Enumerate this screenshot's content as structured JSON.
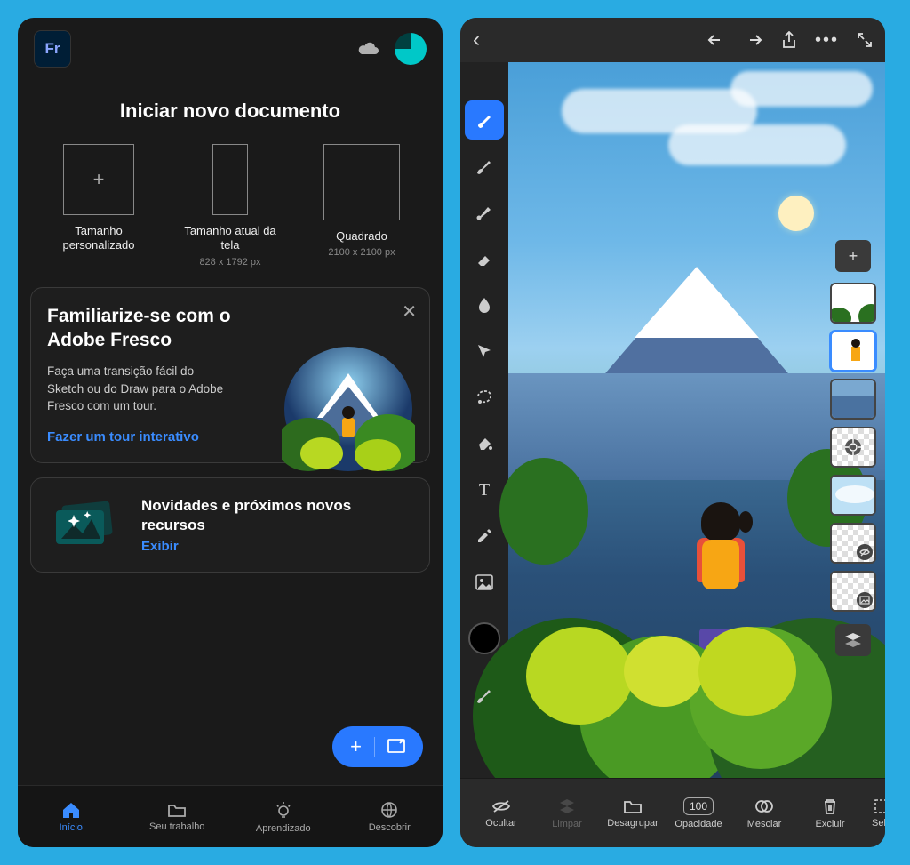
{
  "left": {
    "logo_text": "Fr",
    "section_title": "Iniciar novo documento",
    "presets": {
      "custom": {
        "label": "Tamanho personalizado",
        "plus": "+"
      },
      "screen": {
        "label": "Tamanho atual da tela",
        "dim": "828 x 1792 px"
      },
      "square": {
        "label": "Quadrado",
        "dim": "2100 x 2100 px"
      }
    },
    "tour_card": {
      "title": "Familiarize-se com o Adobe Fresco",
      "body": "Faça uma transição fácil do Sketch ou do Draw para o Adobe Fresco com um tour.",
      "link": "Fazer um tour interativo",
      "close": "✕"
    },
    "news_card": {
      "title": "Novidades e próximos novos recursos",
      "link": "Exibir"
    },
    "fab": {
      "plus": "+"
    },
    "tabs": [
      {
        "label": "Início"
      },
      {
        "label": "Seu trabalho"
      },
      {
        "label": "Aprendizado"
      },
      {
        "label": "Descobrir"
      }
    ]
  },
  "right": {
    "topbar": {
      "back": "‹",
      "more": "•••"
    },
    "tools": [
      {
        "name": "pixel-brush",
        "active": true
      },
      {
        "name": "live-brush"
      },
      {
        "name": "vector-brush"
      },
      {
        "name": "eraser"
      },
      {
        "name": "smudge"
      },
      {
        "name": "move"
      },
      {
        "name": "lasso"
      },
      {
        "name": "fill"
      },
      {
        "name": "text",
        "glyph": "T"
      },
      {
        "name": "eyedropper"
      },
      {
        "name": "image"
      }
    ],
    "color_swatch": "#000000",
    "layers_add": "+",
    "bottom": [
      {
        "name": "hide",
        "label": "Ocultar"
      },
      {
        "name": "clear",
        "label": "Limpar",
        "dim": true
      },
      {
        "name": "ungroup",
        "label": "Desagrupar"
      },
      {
        "name": "opacity",
        "label": "Opacidade",
        "value": "100"
      },
      {
        "name": "merge",
        "label": "Mesclar"
      },
      {
        "name": "delete",
        "label": "Excluir"
      },
      {
        "name": "select",
        "label": "Sele"
      }
    ]
  }
}
